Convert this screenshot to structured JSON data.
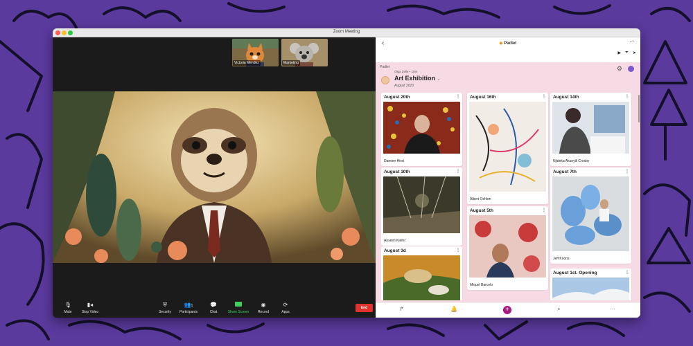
{
  "window": {
    "title": "Zoom Meeting"
  },
  "zoom": {
    "participants": [
      {
        "name": "Victoria Mendez"
      },
      {
        "name": "Marketing"
      }
    ],
    "controls": {
      "mute": "Mute",
      "stop_video": "Stop Video",
      "security": "Security",
      "participants": "Participants",
      "participants_count": "1",
      "chat": "Chat",
      "share_screen": "Share Screen",
      "record": "Record",
      "apps": "Apps",
      "end": "End"
    }
  },
  "padlet": {
    "app_name": "Padlet",
    "breadcrumb": "Padlet",
    "author": "Olga Zelle • 10m",
    "board_title": "Art Exhibition",
    "board_subtitle": "August 2023",
    "cards": [
      {
        "title": "August 20th",
        "caption": "Damien Hirst"
      },
      {
        "title": "August 16th",
        "caption": "Albert Oehlen"
      },
      {
        "title": "August 14th",
        "caption": "Njideka Akunyili Crosby"
      },
      {
        "title": "August 10th",
        "caption": "Anselm Kiefer"
      },
      {
        "title": "August 5th",
        "caption": "Miquel Barcelo"
      },
      {
        "title": "August 7th",
        "caption": "Jeff Koons"
      },
      {
        "title": "August 3d",
        "caption": ""
      },
      {
        "title": "August 1st. Opening",
        "caption": ""
      }
    ]
  },
  "colors": {
    "background": "#5b3a9e",
    "padlet_bg": "#f7dbe4",
    "end_button": "#e0332d",
    "share_green": "#3fd15e",
    "add_button": "#a3197c"
  }
}
